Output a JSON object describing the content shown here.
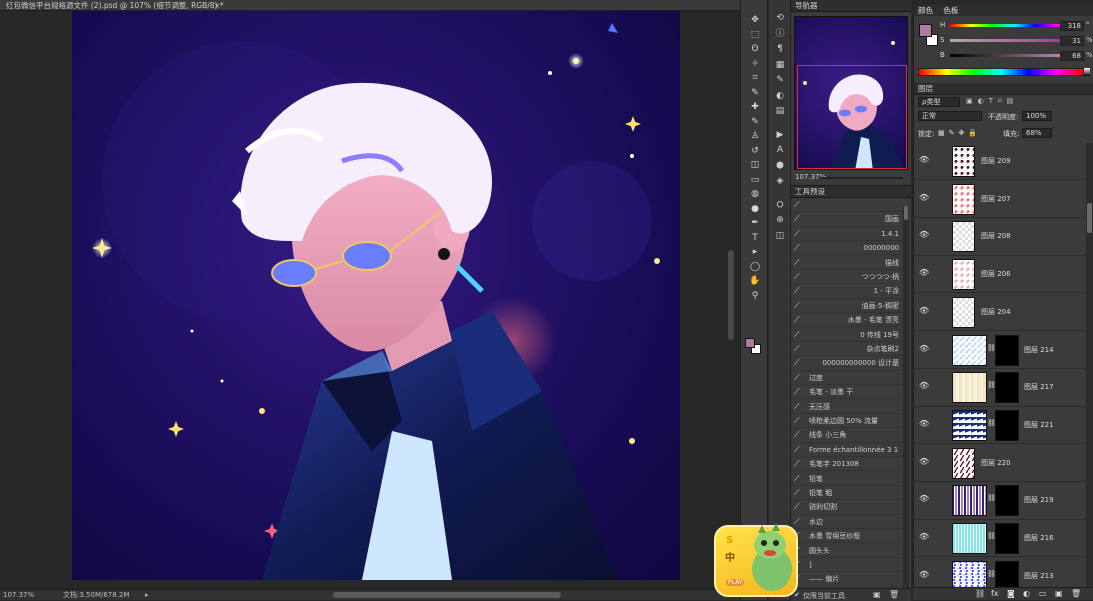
{
  "window": {
    "title": "红包微信平台规格源文件 (2).psd @ 107% (细节调整, RGB/8) *",
    "close_glyph": "×"
  },
  "status": {
    "zoom": "107.37%",
    "doc": "文档:3.50M/678.2M",
    "arrow": "▸"
  },
  "toolbar": {
    "tools": [
      "move-icon",
      "marquee-icon",
      "lasso-icon",
      "magic-wand-icon",
      "crop-icon",
      "eyedropper-icon",
      "healing-icon",
      "brush-icon",
      "stamp-icon",
      "history-brush-icon",
      "eraser-icon",
      "gradient-icon",
      "blur-icon",
      "dodge-icon",
      "pen-icon",
      "type-icon",
      "path-select-icon",
      "shape-icon",
      "hand-icon",
      "zoom-icon"
    ],
    "glyphs": [
      "✥",
      "⬚",
      "ʘ",
      "✧",
      "⌗",
      "✎",
      "✚",
      "✎",
      "♙",
      "↺",
      "◫",
      "▭",
      "◍",
      "●",
      "✒",
      "T",
      "▸",
      "◯",
      "✋",
      "⚲"
    ]
  },
  "strip": {
    "icons": [
      "history-icon",
      "info-icon",
      "paragraph-icon",
      "swatch-icon",
      "brush-panel-icon",
      "adjust-icon",
      "actions-icon",
      "play-icon",
      "char-icon",
      "3d-icon",
      "paths-icon",
      "tool-presets-icon",
      "clone-icon",
      "channels-icon"
    ],
    "glyphs": [
      "⟲",
      "ⓘ",
      "¶",
      "▦",
      "✎",
      "◐",
      "▤",
      "▶",
      "A",
      "⬢",
      "◈",
      "⛭",
      "⊕",
      "◫"
    ]
  },
  "navigator": {
    "title": "导航器",
    "zoom": "107.37%"
  },
  "presets": {
    "title": "工具预设",
    "items": [
      {
        "label": "",
        "align": "right"
      },
      {
        "label": "国画",
        "align": "right"
      },
      {
        "label": "1.4.1",
        "align": "right"
      },
      {
        "label": "00000000",
        "align": "right"
      },
      {
        "label": "描线",
        "align": "right"
      },
      {
        "label": "つつつつ-柄",
        "align": "right"
      },
      {
        "label": "1 - 平涂",
        "align": "right"
      },
      {
        "label": "油画-5-稠密",
        "align": "right"
      },
      {
        "label": "水墨 - 毛笔 漂亮",
        "align": "right"
      },
      {
        "label": "0 传线 19号",
        "align": "right"
      },
      {
        "label": "杂点笔刷2",
        "align": "right"
      },
      {
        "label": "000000000000 设计基",
        "align": "right"
      },
      {
        "label": "过度",
        "align": "left"
      },
      {
        "label": "毛笔 - 淡墨 干",
        "align": "left"
      },
      {
        "label": "无压感",
        "align": "left"
      },
      {
        "label": "喷枪柔边圆 50% 流量",
        "align": "left"
      },
      {
        "label": "线条 小三角",
        "align": "left"
      },
      {
        "label": "Forme échantillonnée 3 1",
        "align": "left"
      },
      {
        "label": "毛笔字 201308",
        "align": "left"
      },
      {
        "label": "铅笔",
        "align": "left"
      },
      {
        "label": "铅笔 粗",
        "align": "left"
      },
      {
        "label": "锐利切割",
        "align": "left"
      },
      {
        "label": "水边",
        "align": "left"
      },
      {
        "label": "水墨 雪绵豆纱般",
        "align": "left"
      },
      {
        "label": "圆头头",
        "align": "left"
      },
      {
        "label": "]",
        "align": "left"
      },
      {
        "label": "—— 偏片",
        "align": "left"
      }
    ],
    "footer_label": "仅限当前工具"
  },
  "color": {
    "tab1": "颜色",
    "tab2": "色板",
    "h_label": "H",
    "s_label": "S",
    "b_label": "B",
    "h": "318",
    "s": "31",
    "b": "68",
    "deg": "°",
    "pct": "%",
    "fg_color": "#ad7aa0",
    "bg_color": "#ffffff"
  },
  "layers": {
    "title": "图层",
    "filter_label": "ρ类型",
    "blend_mode": "正常",
    "opacity_label": "不透明度:",
    "opacity": "100%",
    "lock_label": "锁定:",
    "fill_label": "填充:",
    "fill": "68%",
    "rows": [
      {
        "name": "图层 209",
        "has_mask": false
      },
      {
        "name": "图层 207",
        "has_mask": false
      },
      {
        "name": "图层 208",
        "has_mask": false
      },
      {
        "name": "图层 206",
        "has_mask": false
      },
      {
        "name": "图层 204",
        "has_mask": false
      },
      {
        "name": "图层 214",
        "has_mask": true
      },
      {
        "name": "图层 217",
        "has_mask": true
      },
      {
        "name": "图层 221",
        "has_mask": true
      },
      {
        "name": "图层 220",
        "has_mask": false
      },
      {
        "name": "图层 219",
        "has_mask": true
      },
      {
        "name": "图层 216",
        "has_mask": true
      },
      {
        "name": "图层 213",
        "has_mask": true
      }
    ]
  },
  "widget": {
    "top_char": "S",
    "mid_char": "中",
    "play": "PLAY"
  }
}
